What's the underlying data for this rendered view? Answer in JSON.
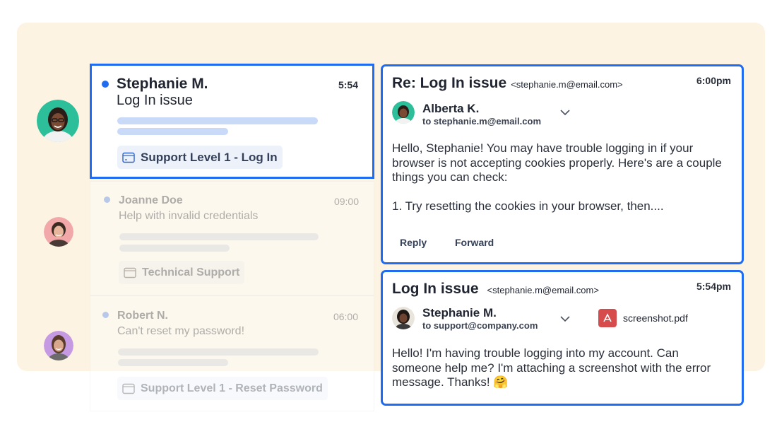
{
  "inbox": {
    "items": [
      {
        "name": "Stephanie M.",
        "subject": "Log In issue",
        "time": "5:54",
        "tag": "Support Level 1 - Log In",
        "unread": true,
        "selected": true
      },
      {
        "name": "Joanne Doe",
        "subject": "Help with invalid credentials",
        "time": "09:00",
        "tag": "Technical Support",
        "unread": true,
        "selected": false
      },
      {
        "name": "Robert N.",
        "subject": "Can't reset my password!",
        "time": "06:00",
        "tag": "Support Level 1 - Reset Password",
        "unread": true,
        "selected": false
      }
    ]
  },
  "reply_email": {
    "subject": "Re: Log In issue",
    "address": "<stephanie.m@email.com>",
    "time": "6:00pm",
    "sender": "Alberta K.",
    "to": "to stephanie.m@email.com",
    "body": [
      "Hello, Stephanie! You may have trouble logging in if your browser is not accepting cookies properly. Here's are a couple things you can check:",
      "1. Try resetting the cookies in your browser, then...."
    ],
    "actions": {
      "reply": "Reply",
      "forward": "Forward"
    }
  },
  "original_email": {
    "subject": "Log In issue",
    "address": "<stephanie.m@email.com>",
    "time": "5:54pm",
    "sender": "Stephanie M.",
    "to": "to support@company.com",
    "attachment": "screenshot.pdf",
    "body": "Hello! I'm having trouble logging into my account. Can someone help me? I'm attaching a screenshot with the error message. Thanks! 🤗"
  },
  "colors": {
    "accent": "#1f6cf0",
    "backdrop": "#fdf3e3",
    "pdf": "#d64b4b"
  },
  "icons": [
    "ticket-tag-icon",
    "chevron-down-icon",
    "pdf-icon",
    "unread-dot-icon"
  ]
}
